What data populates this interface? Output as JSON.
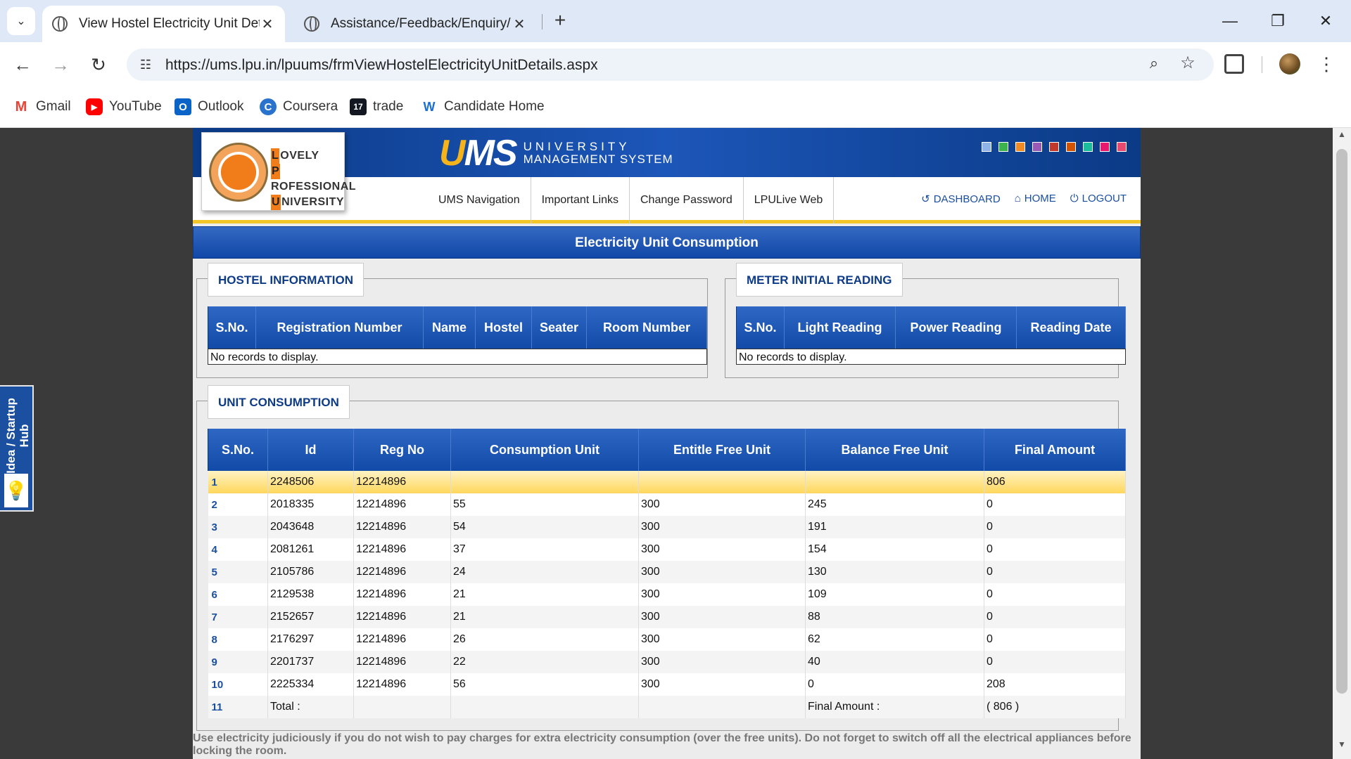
{
  "browser": {
    "tabs": [
      {
        "title": "View Hostel Electricity Unit Details",
        "active": true
      },
      {
        "title": "Assistance/Feedback/Enquiry/M",
        "active": false
      }
    ],
    "url": "https://ums.lpu.in/lpuums/frmViewHostelElectricityUnitDetails.aspx",
    "bookmarks": [
      {
        "label": "Gmail",
        "icon": "gmail-icon",
        "color": "#ea4335",
        "glyph": "M"
      },
      {
        "label": "YouTube",
        "icon": "youtube-icon",
        "color": "#ff0000",
        "glyph": "▶"
      },
      {
        "label": "Outlook",
        "icon": "outlook-icon",
        "color": "#0a64c8",
        "glyph": "O"
      },
      {
        "label": "Coursera",
        "icon": "coursera-icon",
        "color": "#2a73cc",
        "glyph": "C"
      },
      {
        "label": "trade",
        "icon": "tradingview-icon",
        "color": "#131722",
        "glyph": "17"
      },
      {
        "label": "Candidate Home",
        "icon": "candidate-home-icon",
        "color": "#f0a41a",
        "glyph": "W"
      }
    ]
  },
  "side_widget": {
    "label": "Idea / Startup Hub"
  },
  "site": {
    "logo": {
      "line1": "OVELY",
      "line2": "ROFESSIONAL",
      "line3": "NIVERSITY",
      "l1": "L",
      "l2": "P",
      "l3": "U"
    },
    "ums": {
      "word_u": "U",
      "word_rest": "MS",
      "sub1": "UNIVERSITY",
      "sub2": "MANAGEMENT SYSTEM"
    },
    "theme_colors": [
      "#8fb3e6",
      "#3cb44b",
      "#f08c28",
      "#9b59b6",
      "#c0392b",
      "#d35400",
      "#1abc9c",
      "#e6196e",
      "#e84a6f"
    ],
    "nav": [
      "UMS Navigation",
      "Important Links",
      "Change Password",
      "LPULive Web"
    ],
    "actions": [
      {
        "label": "DASHBOARD",
        "icon": "dashboard-icon"
      },
      {
        "label": "HOME",
        "icon": "home-icon"
      },
      {
        "label": "LOGOUT",
        "icon": "logout-icon"
      }
    ],
    "page_title": "Electricity Unit Consumption"
  },
  "hostel_info": {
    "legend": "HOSTEL INFORMATION",
    "columns": [
      "S.No.",
      "Registration Number",
      "Name",
      "Hostel",
      "Seater",
      "Room Number"
    ],
    "empty_text": "No records to display."
  },
  "meter_reading": {
    "legend": "METER INITIAL READING",
    "columns": [
      "S.No.",
      "Light Reading",
      "Power Reading",
      "Reading Date"
    ],
    "empty_text": "No records to display."
  },
  "unit_consumption": {
    "legend": "UNIT CONSUMPTION",
    "columns": [
      "S.No.",
      "Id",
      "Reg No",
      "Consumption Unit",
      "Entitle Free Unit",
      "Balance Free Unit",
      "Final Amount"
    ],
    "rows": [
      [
        "1",
        "2248506",
        "12214896",
        "",
        "",
        "",
        "806"
      ],
      [
        "2",
        "2018335",
        "12214896",
        "55",
        "300",
        "245",
        "0"
      ],
      [
        "3",
        "2043648",
        "12214896",
        "54",
        "300",
        "191",
        "0"
      ],
      [
        "4",
        "2081261",
        "12214896",
        "37",
        "300",
        "154",
        "0"
      ],
      [
        "5",
        "2105786",
        "12214896",
        "24",
        "300",
        "130",
        "0"
      ],
      [
        "6",
        "2129538",
        "12214896",
        "21",
        "300",
        "109",
        "0"
      ],
      [
        "7",
        "2152657",
        "12214896",
        "21",
        "300",
        "88",
        "0"
      ],
      [
        "8",
        "2176297",
        "12214896",
        "26",
        "300",
        "62",
        "0"
      ],
      [
        "9",
        "2201737",
        "12214896",
        "22",
        "300",
        "40",
        "0"
      ],
      [
        "10",
        "2225334",
        "12214896",
        "56",
        "300",
        "0",
        "208"
      ],
      [
        "11",
        "Total :",
        "",
        "",
        "",
        "Final Amount :",
        "( 806 )"
      ]
    ]
  },
  "footer_note": "Use electricity judiciously if you do not wish to pay charges for extra electricity consumption (over the free units). Do not forget to switch off all the electrical appliances before locking the room."
}
